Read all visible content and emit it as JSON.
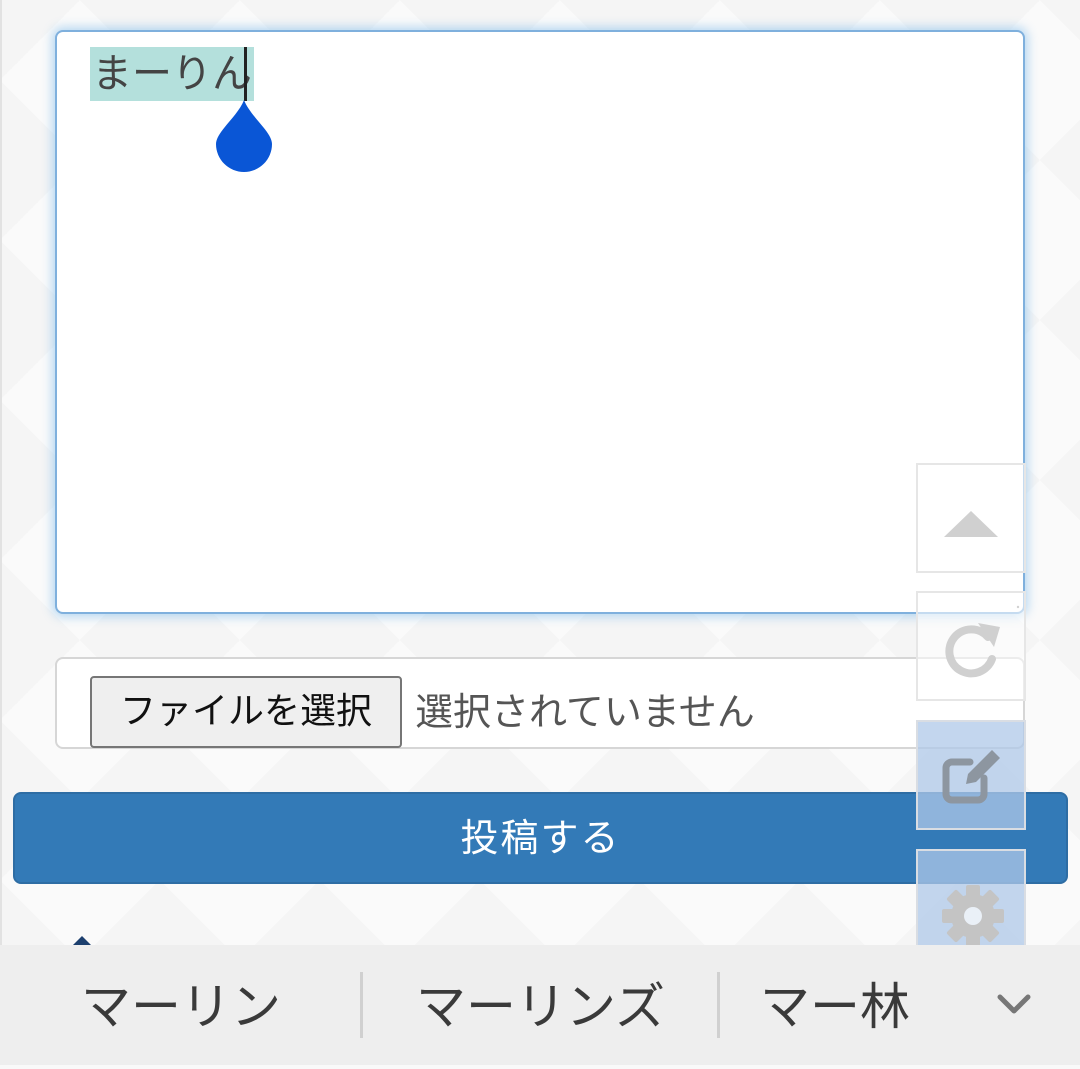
{
  "composer": {
    "text": "まーりん"
  },
  "file_input": {
    "button_label": "ファイルを選択",
    "status": "選択されていません"
  },
  "submit": {
    "label": "投稿する"
  },
  "floating_tools": {
    "items": [
      {
        "icon": "triangle-up-icon"
      },
      {
        "icon": "refresh-icon"
      },
      {
        "icon": "edit-icon"
      },
      {
        "icon": "gear-icon"
      }
    ]
  },
  "ime_suggestions": {
    "items": [
      "マーリン",
      "マーリンズ",
      "マー林"
    ],
    "expand_icon": "chevron-down-icon"
  },
  "colors": {
    "primary": "#337ab7",
    "selection": "#b4e0dc",
    "caret_handle": "#0a56d6",
    "suggest_bar": "#eeeeee"
  }
}
